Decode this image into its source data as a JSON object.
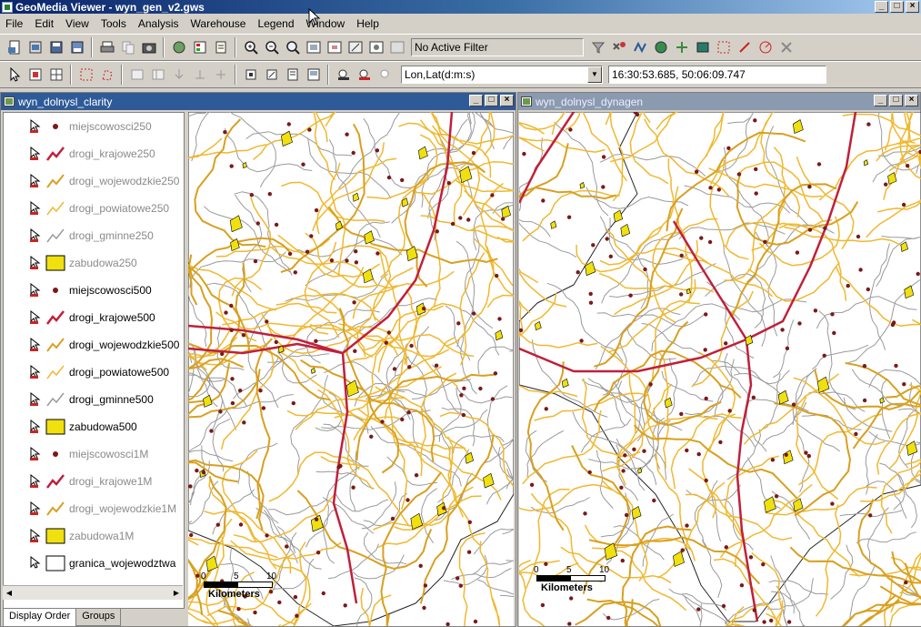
{
  "app": {
    "title": "GeoMedia Viewer - wyn_gen_v2.gws",
    "win_min": "_",
    "win_max": "□",
    "win_close": "×"
  },
  "menu": [
    "File",
    "Edit",
    "View",
    "Tools",
    "Analysis",
    "Warehouse",
    "Legend",
    "Window",
    "Help"
  ],
  "toolbar": {
    "filter_text": "No Active Filter",
    "coord_system": "Lon,Lat(d:m:s)",
    "coord_value": "16:30:53.685, 50:06:09.747"
  },
  "left_window": {
    "title": "wyn_dolnysl_clarity",
    "legend": [
      {
        "label": "miejscowosci250",
        "symbol": "point",
        "dim": true
      },
      {
        "label": "drogi_krajowe250",
        "symbol": "red-line",
        "dim": true
      },
      {
        "label": "drogi_wojewodzkie250",
        "symbol": "gold-line",
        "dim": true
      },
      {
        "label": "drogi_powiatowe250",
        "symbol": "yellow-line",
        "dim": true
      },
      {
        "label": "drogi_gminne250",
        "symbol": "gray-line",
        "dim": true
      },
      {
        "label": "zabudowa250",
        "symbol": "yellow-area",
        "dim": true
      },
      {
        "label": "miejscowosci500",
        "symbol": "point",
        "dim": false
      },
      {
        "label": "drogi_krajowe500",
        "symbol": "red-line",
        "dim": false
      },
      {
        "label": "drogi_wojewodzkie500",
        "symbol": "gold-line",
        "dim": false
      },
      {
        "label": "drogi_powiatowe500",
        "symbol": "yellow-line",
        "dim": false
      },
      {
        "label": "drogi_gminne500",
        "symbol": "gray-line",
        "dim": false
      },
      {
        "label": "zabudowa500",
        "symbol": "yellow-area",
        "dim": false
      },
      {
        "label": "miejscowosci1M",
        "symbol": "point",
        "dim": true
      },
      {
        "label": "drogi_krajowe1M",
        "symbol": "red-line",
        "dim": true
      },
      {
        "label": "drogi_wojewodzkie1M",
        "symbol": "gold-line",
        "dim": true
      },
      {
        "label": "zabudowa1M",
        "symbol": "yellow-area",
        "dim": true
      },
      {
        "label": "granica_wojewodztwa",
        "symbol": "white-area",
        "dim": false
      }
    ],
    "tabs": [
      "Display Order",
      "Groups"
    ],
    "scale": {
      "tick0": "0",
      "tick1": "5",
      "tick2": "10",
      "unit": "Kilometers"
    }
  },
  "right_window": {
    "title": "wyn_dolnysl_dynagen",
    "scale": {
      "tick0": "0",
      "tick1": "5",
      "tick2": "10",
      "unit": "Kilometers"
    }
  },
  "colors": {
    "national_road": "#c0203a",
    "voivodeship_road": "#d8a020",
    "county_road": "#f0b830",
    "local_road": "#9a9a9a",
    "builtup": "#f0e010",
    "settlement": "#7a1a1a"
  }
}
